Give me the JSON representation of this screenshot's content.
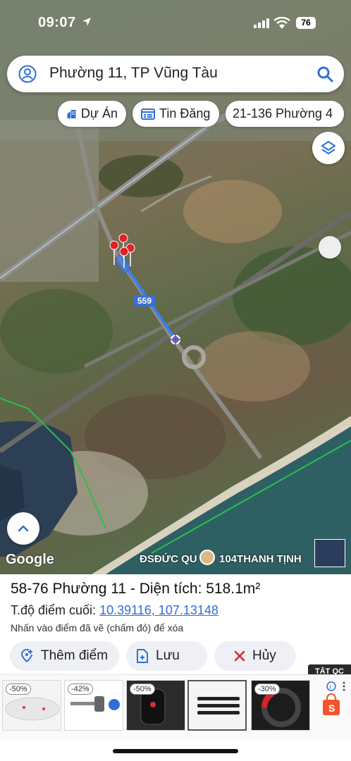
{
  "status_bar": {
    "time": "09:07",
    "battery": "76"
  },
  "search": {
    "query": "Phường 11, TP Vũng Tàu"
  },
  "chips": [
    {
      "label": "Dự Án"
    },
    {
      "label": "Tin Đăng"
    },
    {
      "label": "21-136 Phường 4"
    }
  ],
  "map": {
    "road_badge": "559",
    "google_logo": "Google",
    "place_label_1": "ĐSĐỨC QU",
    "place_label_2": "104THANH TỊNH"
  },
  "info": {
    "title": "58-76 Phường 11 - Diện tích: 518.1m²",
    "coord_label": "T.độ điểm cuối: ",
    "coord_value": "10.39116, 107.13148",
    "hint": "Nhấn vào điểm đã vẽ (chấm đỏ) để xóa"
  },
  "actions": {
    "add_point": "Thêm điểm",
    "save": "Lưu",
    "cancel": "Hủy"
  },
  "ads": {
    "close_label": "TẮT QC",
    "discounts": [
      "-50%",
      "-42%",
      "-50%",
      "",
      "-30%"
    ]
  },
  "colors": {
    "accent": "#2f6fd6",
    "pin": "#e0202a",
    "route": "#3a7ff0",
    "boundary": "#27c24c"
  }
}
